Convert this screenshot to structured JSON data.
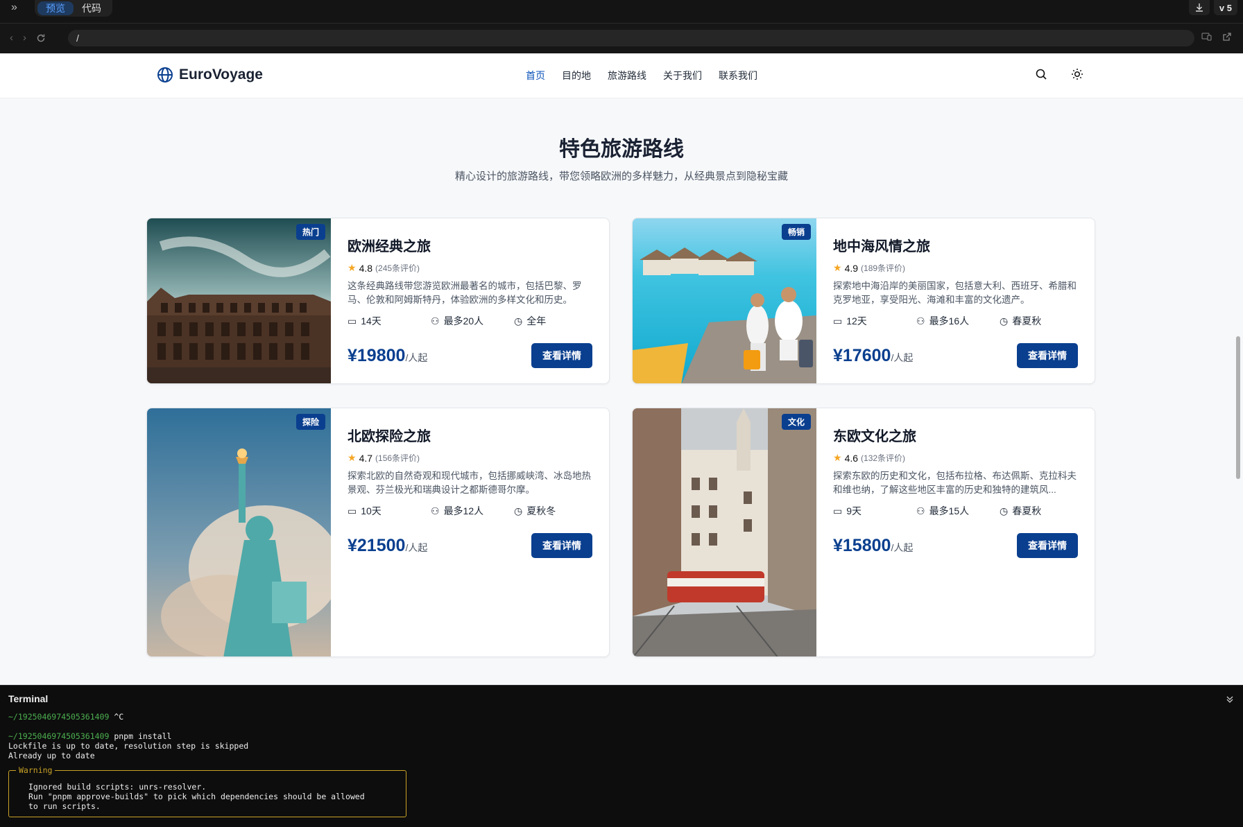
{
  "ide": {
    "tabs": [
      {
        "label": "预览",
        "active": true
      },
      {
        "label": "代码",
        "active": false
      }
    ],
    "version": "v 5"
  },
  "address": {
    "url": "/"
  },
  "site": {
    "brand": "EuroVoyage",
    "nav": [
      "首页",
      "目的地",
      "旅游路线",
      "关于我们",
      "联系我们"
    ],
    "nav_active": 0,
    "accent": "#0a3f8f"
  },
  "section": {
    "title": "特色旅游路线",
    "subtitle": "精心设计的旅游路线，带您领略欧洲的多样魅力，从经典景点到隐秘宝藏"
  },
  "cards": [
    {
      "badge": "热门",
      "title": "欧洲经典之旅",
      "rating": "4.8",
      "reviews": "(245条评价)",
      "desc": "这条经典路线带您游览欧洲最著名的城市，包括巴黎、罗马、伦敦和阿姆斯特丹，体验欧洲的多样文化和历史。",
      "days": "14天",
      "group": "最多20人",
      "season": "全年",
      "price": "¥19800",
      "unit": "/人起",
      "button": "查看详情",
      "image": "colosseum-photo"
    },
    {
      "badge": "畅销",
      "title": "地中海风情之旅",
      "rating": "4.9",
      "reviews": "(189条评价)",
      "desc": "探索地中海沿岸的美丽国家，包括意大利、西班牙、希腊和克罗地亚，享受阳光、海滩和丰富的文化遗产。",
      "days": "12天",
      "group": "最多16人",
      "season": "春夏秋",
      "price": "¥17600",
      "unit": "/人起",
      "button": "查看详情",
      "image": "beach-resort-photo"
    },
    {
      "badge": "探险",
      "title": "北欧探险之旅",
      "rating": "4.7",
      "reviews": "(156条评价)",
      "desc": "探索北欧的自然奇观和现代城市，包括挪威峡湾、冰岛地热景观、芬兰极光和瑞典设计之都斯德哥尔摩。",
      "days": "10天",
      "group": "最多12人",
      "season": "夏秋冬",
      "price": "¥21500",
      "unit": "/人起",
      "button": "查看详情",
      "image": "statue-of-liberty-photo"
    },
    {
      "badge": "文化",
      "title": "东欧文化之旅",
      "rating": "4.6",
      "reviews": "(132条评价)",
      "desc": "探索东欧的历史和文化，包括布拉格、布达佩斯、克拉科夫和维也纳，了解这些地区丰富的历史和独特的建筑风...",
      "days": "9天",
      "group": "最多15人",
      "season": "春夏秋",
      "price": "¥15800",
      "unit": "/人起",
      "button": "查看详情",
      "image": "prague-tram-photo"
    }
  ],
  "terminal": {
    "title": "Terminal",
    "lines": [
      {
        "prompt": "~/1925046974505361409",
        "cmd": " ^C"
      },
      {
        "prompt": "",
        "cmd": ""
      },
      {
        "prompt": "~/1925046974505361409",
        "cmd": " pnpm install"
      },
      {
        "prompt": "",
        "cmd": "Lockfile is up to date, resolution step is skipped"
      },
      {
        "prompt": "",
        "cmd": "Already up to date"
      }
    ],
    "warning_label": "Warning",
    "warning_lines": [
      "Ignored build scripts: unrs-resolver.",
      "Run \"pnpm approve-builds\" to pick which dependencies should be allowed",
      "to run scripts."
    ]
  }
}
